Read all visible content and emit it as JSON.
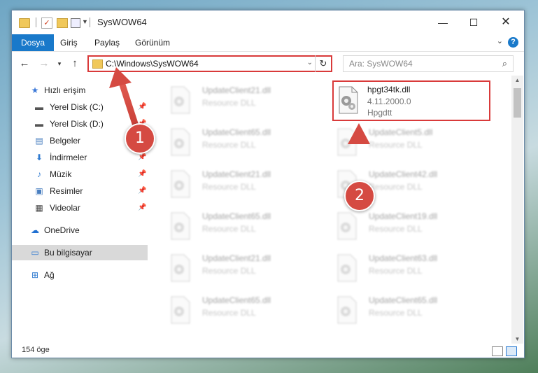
{
  "window": {
    "title": "SysWOW64",
    "controls": {
      "minimize": "—",
      "maximize": "☐",
      "close": "✕"
    }
  },
  "ribbon": {
    "tabs": [
      {
        "label": "Dosya",
        "active": true
      },
      {
        "label": "Giriş"
      },
      {
        "label": "Paylaş"
      },
      {
        "label": "Görünüm"
      }
    ],
    "help": "?"
  },
  "address": {
    "path": "C:\\Windows\\SysWOW64"
  },
  "search": {
    "placeholder": "Ara: SysWOW64"
  },
  "sidebar": {
    "items": [
      {
        "label": "Hızlı erişim",
        "icon": "star-icon",
        "pinned": false
      },
      {
        "label": "Yerel Disk (C:)",
        "icon": "drive-icon",
        "pinned": true
      },
      {
        "label": "Yerel Disk (D:)",
        "icon": "drive-icon",
        "pinned": true
      },
      {
        "label": "Belgeler",
        "icon": "documents-icon",
        "pinned": true
      },
      {
        "label": "İndirmeler",
        "icon": "download-icon",
        "pinned": true
      },
      {
        "label": "Müzik",
        "icon": "music-icon",
        "pinned": true
      },
      {
        "label": "Resimler",
        "icon": "pictures-icon",
        "pinned": true
      },
      {
        "label": "Videolar",
        "icon": "videos-icon",
        "pinned": true
      },
      {
        "label": "OneDrive",
        "icon": "cloud-icon",
        "pinned": false
      },
      {
        "label": "Bu bilgisayar",
        "icon": "computer-icon",
        "pinned": false,
        "selected": true
      },
      {
        "label": "Ağ",
        "icon": "network-icon",
        "pinned": false
      }
    ]
  },
  "files": {
    "left_column": [
      {
        "name": "UpdateClient21.dll",
        "desc": "Resource DLL"
      },
      {
        "name": "UpdateClient65.dll",
        "desc": "Resource DLL"
      },
      {
        "name": "UpdateClient21.dll",
        "desc": "Resource DLL"
      },
      {
        "name": "UpdateClient65.dll",
        "desc": "Resource DLL"
      },
      {
        "name": "UpdateClient21.dll",
        "desc": "Resource DLL"
      },
      {
        "name": "UpdateClient65.dll",
        "desc": "Resource DLL"
      }
    ],
    "right_column": [
      {
        "name": "UpdateClient5.dll",
        "desc": "Resource DLL"
      },
      {
        "name": "UpdateClient42.dll",
        "desc": "Resource DLL"
      },
      {
        "name": "UpdateClient19.dll",
        "desc": "Resource DLL"
      },
      {
        "name": "UpdateClient63.dll",
        "desc": "Resource DLL"
      },
      {
        "name": "UpdateClient65.dll",
        "desc": "Resource DLL"
      }
    ],
    "highlighted": {
      "name": "hpgt34tk.dll",
      "version": "4.11.2000.0",
      "company": "Hpgdtt"
    }
  },
  "status": {
    "count": "154 öge"
  },
  "annotations": {
    "badge1": "1",
    "badge2": "2",
    "color": "#d93a3a"
  }
}
